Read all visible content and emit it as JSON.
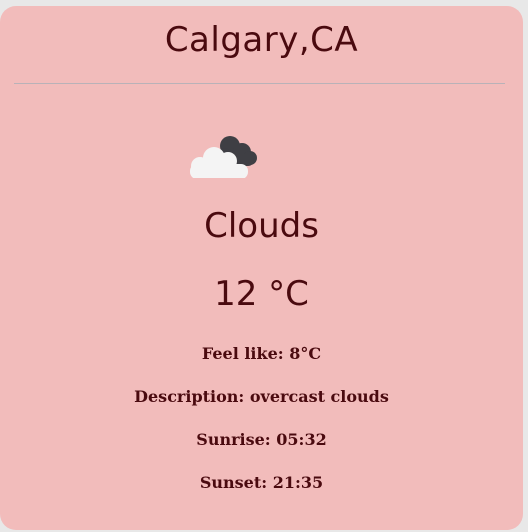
{
  "location": {
    "city": "Calgary,CA"
  },
  "weather": {
    "icon": "cloud-icon",
    "condition": "Clouds",
    "temperature": "12 °C",
    "feels_like": "Feel like: 8°C",
    "description": "Description: overcast clouds",
    "sunrise": "Sunrise: 05:32",
    "sunset": "Sunset: 21:35"
  },
  "colors": {
    "card_background": "#f2bcbb",
    "text": "#4a0a0f",
    "page_background": "#e8e8e8"
  }
}
